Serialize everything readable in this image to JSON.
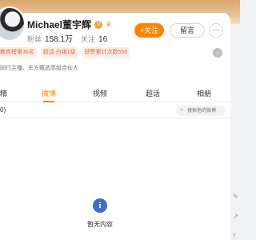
{
  "profile": {
    "name": "Michael董宇辉",
    "vip_badge": "V",
    "crown_icon": "crown-icon",
    "fans_label": "粉丝",
    "fans_count": "158.1万",
    "following_label": "关注",
    "following_count": "16"
  },
  "actions": {
    "follow_label": "+关注",
    "message_label": "留言",
    "more_label": "···"
  },
  "tags": [
    "教育榜第36名",
    "超话 白银1级",
    "获赞累计次数558"
  ],
  "description": "同行主播、东方甄选高级合伙人",
  "tabs": {
    "t0": "精",
    "t1": "微博",
    "t2": "视频",
    "t3": "超话",
    "t4": "相册"
  },
  "feed": {
    "count": "0)",
    "search_placeholder": "搜索他的微博"
  },
  "empty": {
    "icon": "i",
    "message": "暂无内容"
  },
  "colors": {
    "accent": "#ff8200",
    "tag_bg": "#fdeee6",
    "tag_text": "#e8673a",
    "info_icon": "#3b6fc9"
  }
}
